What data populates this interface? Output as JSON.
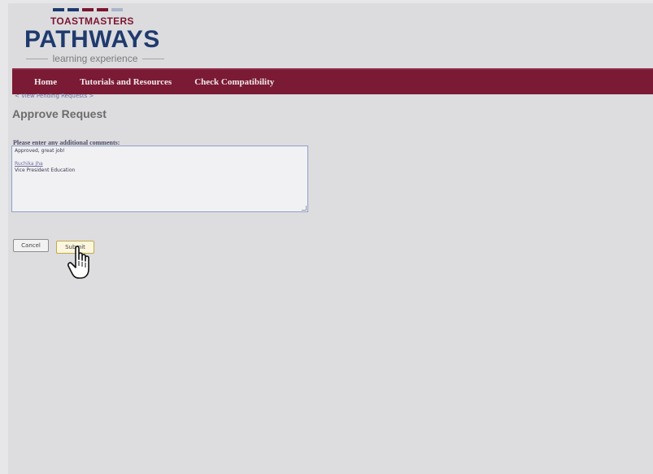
{
  "logo": {
    "top_text": "TOASTMASTERS",
    "main_text": "PATHWAYS",
    "sub_text": "learning experience",
    "stripe_colors": [
      "#1e3a6e",
      "#1e3a6e",
      "#7b1530",
      "#7b1530",
      "#a8b4c8"
    ]
  },
  "nav": {
    "items": [
      {
        "label": "Home"
      },
      {
        "label": "Tutorials and Resources"
      },
      {
        "label": "Check Compatibility"
      }
    ]
  },
  "breadcrumb": "< View Pending Requests >",
  "page_title": "Approve Request",
  "comments": {
    "label": "Please enter any additional comments:",
    "line1": "Approved, great job!",
    "signature_name": "Ruchika Jha",
    "signature_title": "Vice President Education"
  },
  "buttons": {
    "cancel": "Cancel",
    "submit": "Submit"
  },
  "colors": {
    "nav_bg": "#7a1a34",
    "brand_blue": "#1f3a6d",
    "brand_red": "#7b1530"
  },
  "icons": {
    "cursor": "hand-pointer-icon"
  }
}
